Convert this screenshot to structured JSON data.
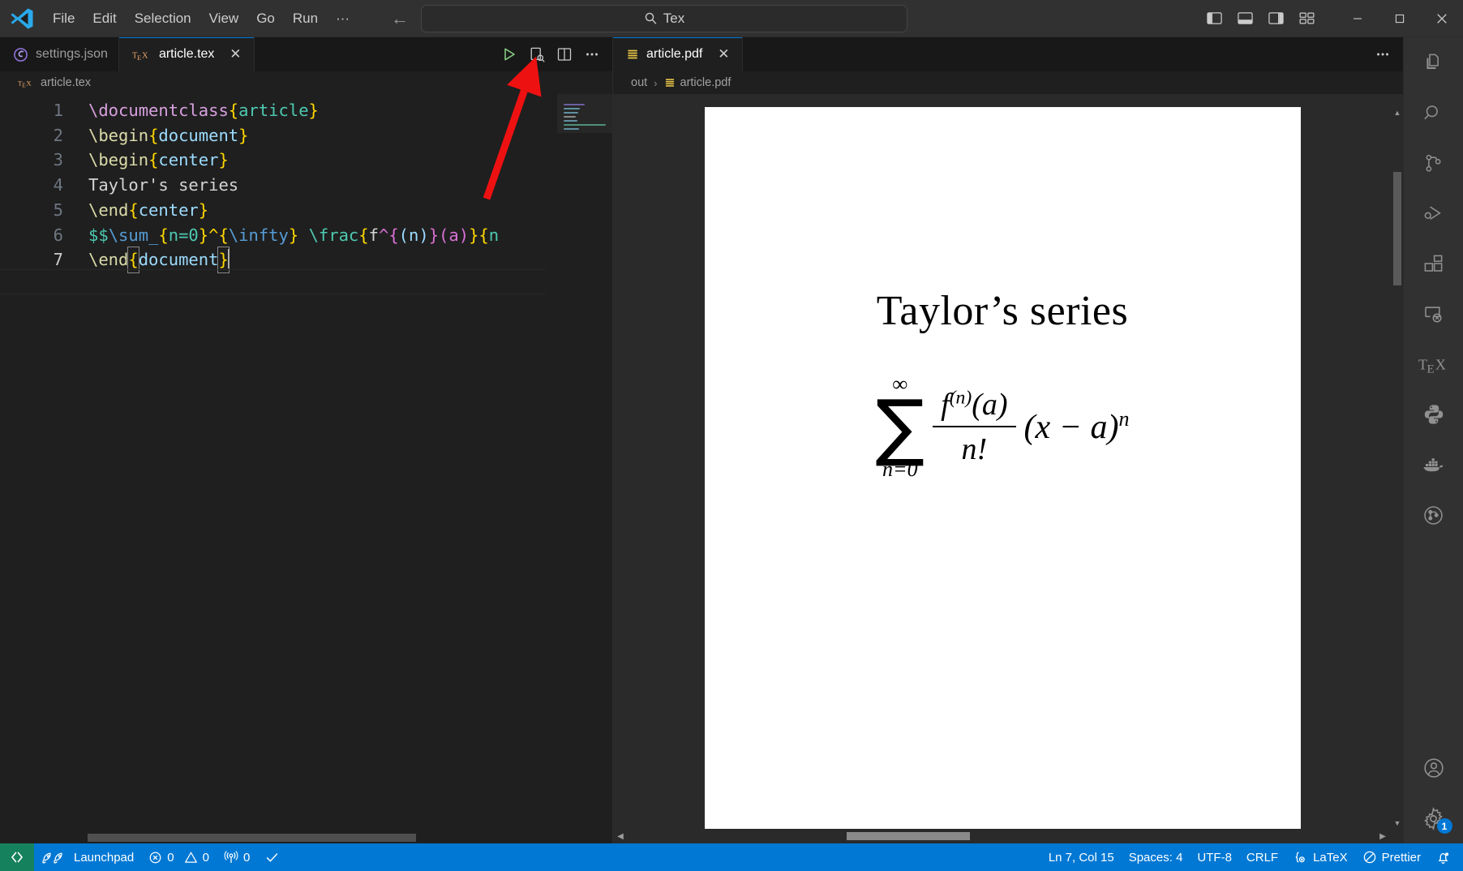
{
  "window": {
    "logo": "vscode-logo",
    "menu": [
      "File",
      "Edit",
      "Selection",
      "View",
      "Go",
      "Run",
      "···"
    ],
    "nav_back": "←",
    "nav_forward": "→",
    "search_text": "Tex",
    "search_icon": "search-icon",
    "layout_icons": [
      "toggle-primary-sidebar-icon",
      "toggle-panel-icon",
      "toggle-secondary-sidebar-icon",
      "customize-layout-icon"
    ],
    "minimize": "─",
    "maximize": "☐",
    "close": "✕"
  },
  "editor_group_left": {
    "tabs": [
      {
        "label": "settings.json",
        "icon": "json-settings-icon",
        "active": false,
        "closable": false
      },
      {
        "label": "article.tex",
        "icon": "tex-icon",
        "active": true,
        "closable": true,
        "close": "✕"
      }
    ],
    "actions": [
      "run-build-latex-icon",
      "view-latex-pdf-icon",
      "split-editor-right-icon",
      "more-actions-icon"
    ],
    "breadcrumb": {
      "icon": "tex-icon",
      "path": [
        "article.tex"
      ]
    },
    "code_lines": [
      {
        "n": 1,
        "tokens": [
          {
            "t": "\\documentclass",
            "c": "cmd"
          },
          {
            "t": "{",
            "c": "brc"
          },
          {
            "t": "article",
            "c": "nm"
          },
          {
            "t": "}",
            "c": "brc"
          }
        ]
      },
      {
        "n": 2,
        "tokens": [
          {
            "t": "\\begin",
            "c": "yel"
          },
          {
            "t": "{",
            "c": "brc"
          },
          {
            "t": "document",
            "c": "arg"
          },
          {
            "t": "}",
            "c": "brc"
          }
        ]
      },
      {
        "n": 3,
        "tokens": [
          {
            "t": "\\begin",
            "c": "yel"
          },
          {
            "t": "{",
            "c": "brc"
          },
          {
            "t": "center",
            "c": "arg"
          },
          {
            "t": "}",
            "c": "brc"
          }
        ]
      },
      {
        "n": 4,
        "tokens": [
          {
            "t": "Taylor's series",
            "c": "pln"
          }
        ]
      },
      {
        "n": 5,
        "tokens": [
          {
            "t": "\\end",
            "c": "yel"
          },
          {
            "t": "{",
            "c": "brc"
          },
          {
            "t": "center",
            "c": "arg"
          },
          {
            "t": "}",
            "c": "brc"
          }
        ]
      },
      {
        "n": 6,
        "tokens": [
          {
            "t": "$$",
            "c": "grn"
          },
          {
            "t": "\\sum_",
            "c": "kw"
          },
          {
            "t": "{",
            "c": "brc"
          },
          {
            "t": "n=0",
            "c": "nm"
          },
          {
            "t": "}",
            "c": "brc"
          },
          {
            "t": "^",
            "c": "brc"
          },
          {
            "t": "{",
            "c": "brc"
          },
          {
            "t": "\\infty",
            "c": "kw"
          },
          {
            "t": "}",
            "c": "brc"
          },
          {
            "t": " ",
            "c": "pln"
          },
          {
            "t": "\\frac",
            "c": "grn"
          },
          {
            "t": "{",
            "c": "brc"
          },
          {
            "t": "f",
            "c": "pln"
          },
          {
            "t": "^",
            "c": "brc2"
          },
          {
            "t": "{",
            "c": "brc2"
          },
          {
            "t": "(n)",
            "c": "arg"
          },
          {
            "t": "}",
            "c": "brc2"
          },
          {
            "t": "(a)",
            "c": "brc2"
          },
          {
            "t": "}",
            "c": "brc"
          },
          {
            "t": "{",
            "c": "brc"
          },
          {
            "t": "n",
            "c": "nm"
          }
        ]
      },
      {
        "n": 7,
        "tokens": [
          {
            "t": "\\end",
            "c": "yel"
          },
          {
            "t": "{",
            "c": "brc"
          },
          {
            "t": "document",
            "c": "arg"
          },
          {
            "t": "}",
            "c": "brc"
          }
        ],
        "active": true
      }
    ],
    "cursor_line": 7
  },
  "editor_group_right": {
    "tab": {
      "label": "article.pdf",
      "icon": "pdf-lines-icon",
      "close": "✕"
    },
    "more_actions": "more-actions-icon",
    "breadcrumb": {
      "folder": "out",
      "sep": "›",
      "file": "article.pdf",
      "file_icon": "pdf-lines-icon"
    },
    "pdf": {
      "title": "Taylor’s series",
      "formula": {
        "sum_upper": "∞",
        "sum_symbol": "∑",
        "sum_lower": "n=0",
        "numerator": "f",
        "numerator_sup": "(n)",
        "numerator_arg": "(a)",
        "denominator": "n!",
        "tail": "(x − a)",
        "tail_sup": "n"
      }
    },
    "scroll_up": "▲",
    "scroll_down": "▼",
    "scroll_left": "◀",
    "scroll_right": "▶"
  },
  "activitybar": {
    "items": [
      {
        "name": "explorer-icon",
        "label": "Explorer"
      },
      {
        "name": "search-icon",
        "label": "Search"
      },
      {
        "name": "source-control-icon",
        "label": "Source Control"
      },
      {
        "name": "run-and-debug-icon",
        "label": "Run and Debug"
      },
      {
        "name": "extensions-icon",
        "label": "Extensions"
      },
      {
        "name": "remote-explorer-icon",
        "label": "Remote Explorer"
      },
      {
        "name": "latex-tex-icon",
        "label": "TeX"
      },
      {
        "name": "python-icon",
        "label": "Python"
      },
      {
        "name": "docker-icon",
        "label": "Docker"
      },
      {
        "name": "gitlens-icon",
        "label": "GitLens"
      }
    ],
    "bottom_items": [
      {
        "name": "account-icon",
        "label": "Accounts"
      },
      {
        "name": "settings-gear-icon",
        "label": "Manage",
        "badge": "1"
      }
    ]
  },
  "statusbar": {
    "remote": {
      "icon": "remote-window-icon",
      "label": ""
    },
    "left_items": [
      {
        "name": "launchpad-item",
        "icon": "rocket-icon",
        "label": "Launchpad"
      },
      {
        "name": "problems-item",
        "icon": "error-icon",
        "label": "0",
        "icon2": "warning-icon",
        "label2": "0"
      },
      {
        "name": "ports-item",
        "icon": "radio-tower-icon",
        "label": "0"
      },
      {
        "name": "check-item",
        "icon": "check-icon",
        "label": ""
      }
    ],
    "right_items": [
      {
        "name": "cursor-position-item",
        "label": "Ln 7, Col 15"
      },
      {
        "name": "indentation-item",
        "label": "Spaces: 4"
      },
      {
        "name": "encoding-item",
        "label": "UTF-8"
      },
      {
        "name": "eol-item",
        "label": "CRLF"
      },
      {
        "name": "language-mode-item",
        "icon": "latex-brace-icon",
        "label": "LaTeX"
      },
      {
        "name": "prettier-item",
        "icon": "prettier-circle-icon",
        "label": "Prettier"
      },
      {
        "name": "notifications-item",
        "icon": "bell-dot-icon",
        "label": ""
      }
    ]
  },
  "annotation": {
    "arrow_color": "#ee1111",
    "target": "view-latex-pdf-icon"
  }
}
